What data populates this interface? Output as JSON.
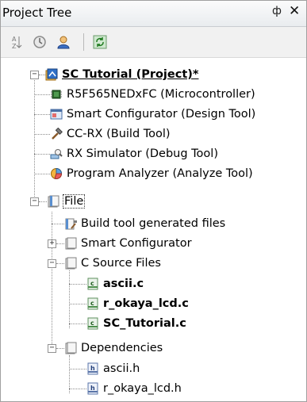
{
  "panel": {
    "title": "Project Tree",
    "pin_glyph": "ф",
    "close_glyph": "✕"
  },
  "toolbar": {
    "buttons": [
      {
        "name": "sort-icon"
      },
      {
        "name": "history-icon"
      },
      {
        "name": "user-icon"
      },
      {
        "name": "refresh-icon"
      }
    ]
  },
  "tree": {
    "project": {
      "label": "SC Tutorial (Project)*",
      "expander": "−"
    },
    "microcontroller": {
      "label": "R5F565NEDxFC (Microcontroller)"
    },
    "design_tool": {
      "label": "Smart Configurator (Design Tool)"
    },
    "build_tool": {
      "label": "CC-RX (Build Tool)"
    },
    "debug_tool": {
      "label": "RX Simulator (Debug Tool)"
    },
    "analyze_tool": {
      "label": "Program Analyzer (Analyze Tool)"
    },
    "file": {
      "label": "File",
      "expander": "−"
    },
    "build_generated": {
      "label": "Build tool generated files"
    },
    "smart_configurator": {
      "label": "Smart Configurator",
      "expander": "+"
    },
    "c_source": {
      "label": "C Source Files",
      "expander": "−"
    },
    "ascii_c": {
      "label": "ascii.c"
    },
    "r_okaya_lcd_c": {
      "label": "r_okaya_lcd.c"
    },
    "sc_tutorial_c": {
      "label": "SC_Tutorial.c"
    },
    "dependencies": {
      "label": "Dependencies",
      "expander": "−"
    },
    "ascii_h": {
      "label": "ascii.h"
    },
    "r_okaya_lcd_h": {
      "label": "r_okaya_lcd.h"
    }
  },
  "colors": {
    "title_bg": "#e9ecef",
    "toolbar_bg": "#f1f1f1",
    "tree_line": "#8d8d8d"
  }
}
